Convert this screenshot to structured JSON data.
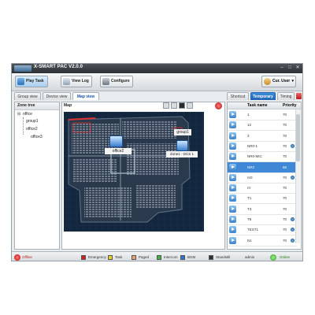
{
  "window": {
    "title": "X-SMART PAC V2.0.0",
    "logo_text": "X-SMART"
  },
  "toolbar": {
    "play_task": "Play Task",
    "view_log": "View Log",
    "configure": "Configure",
    "user": "Cur. User"
  },
  "left_tabs": [
    "Group view",
    "Device view",
    "Map view"
  ],
  "right_tabs": [
    "Shortcut",
    "Temporary",
    "Timing"
  ],
  "zone_tree": {
    "title": "Zone tree",
    "items": [
      "office",
      "group1",
      "office2",
      "office3"
    ]
  },
  "map": {
    "title": "Map",
    "devices": [
      "office2",
      "group1",
      "Zone1 - DCS 1"
    ]
  },
  "task_table": {
    "headers": [
      "Task name",
      "Priority"
    ],
    "rows": [
      {
        "name": "1",
        "priority": "70",
        "status": false
      },
      {
        "name": "12",
        "priority": "70",
        "status": false
      },
      {
        "name": "3",
        "priority": "70",
        "status": false
      },
      {
        "name": "NR0-1",
        "priority": "70",
        "status": true
      },
      {
        "name": "NR0-MIC",
        "priority": "70",
        "status": false
      },
      {
        "name": "NR2",
        "priority": "65",
        "status": false,
        "selected": true
      },
      {
        "name": "nr0",
        "priority": "70",
        "status": true
      },
      {
        "name": "rrr",
        "priority": "70",
        "status": false
      },
      {
        "name": "T1",
        "priority": "70",
        "status": false
      },
      {
        "name": "T3",
        "priority": "70",
        "status": false
      },
      {
        "name": "T6",
        "priority": "70",
        "status": true
      },
      {
        "name": "TEST1",
        "priority": "70",
        "status": true
      },
      {
        "name": "N1",
        "priority": "70",
        "status": true
      }
    ]
  },
  "status": {
    "left": "Offline",
    "legend": [
      {
        "label": "Emergency",
        "color": "#d02020"
      },
      {
        "label": "Task",
        "color": "#e8d020"
      },
      {
        "label": "Paged",
        "color": "#f0a070"
      },
      {
        "label": "Intercom",
        "color": "#40b040"
      },
      {
        "label": "BGM",
        "color": "#3070d0"
      },
      {
        "label": "Standstill",
        "color": "#303030"
      }
    ],
    "user": "admin",
    "right": "Online"
  }
}
